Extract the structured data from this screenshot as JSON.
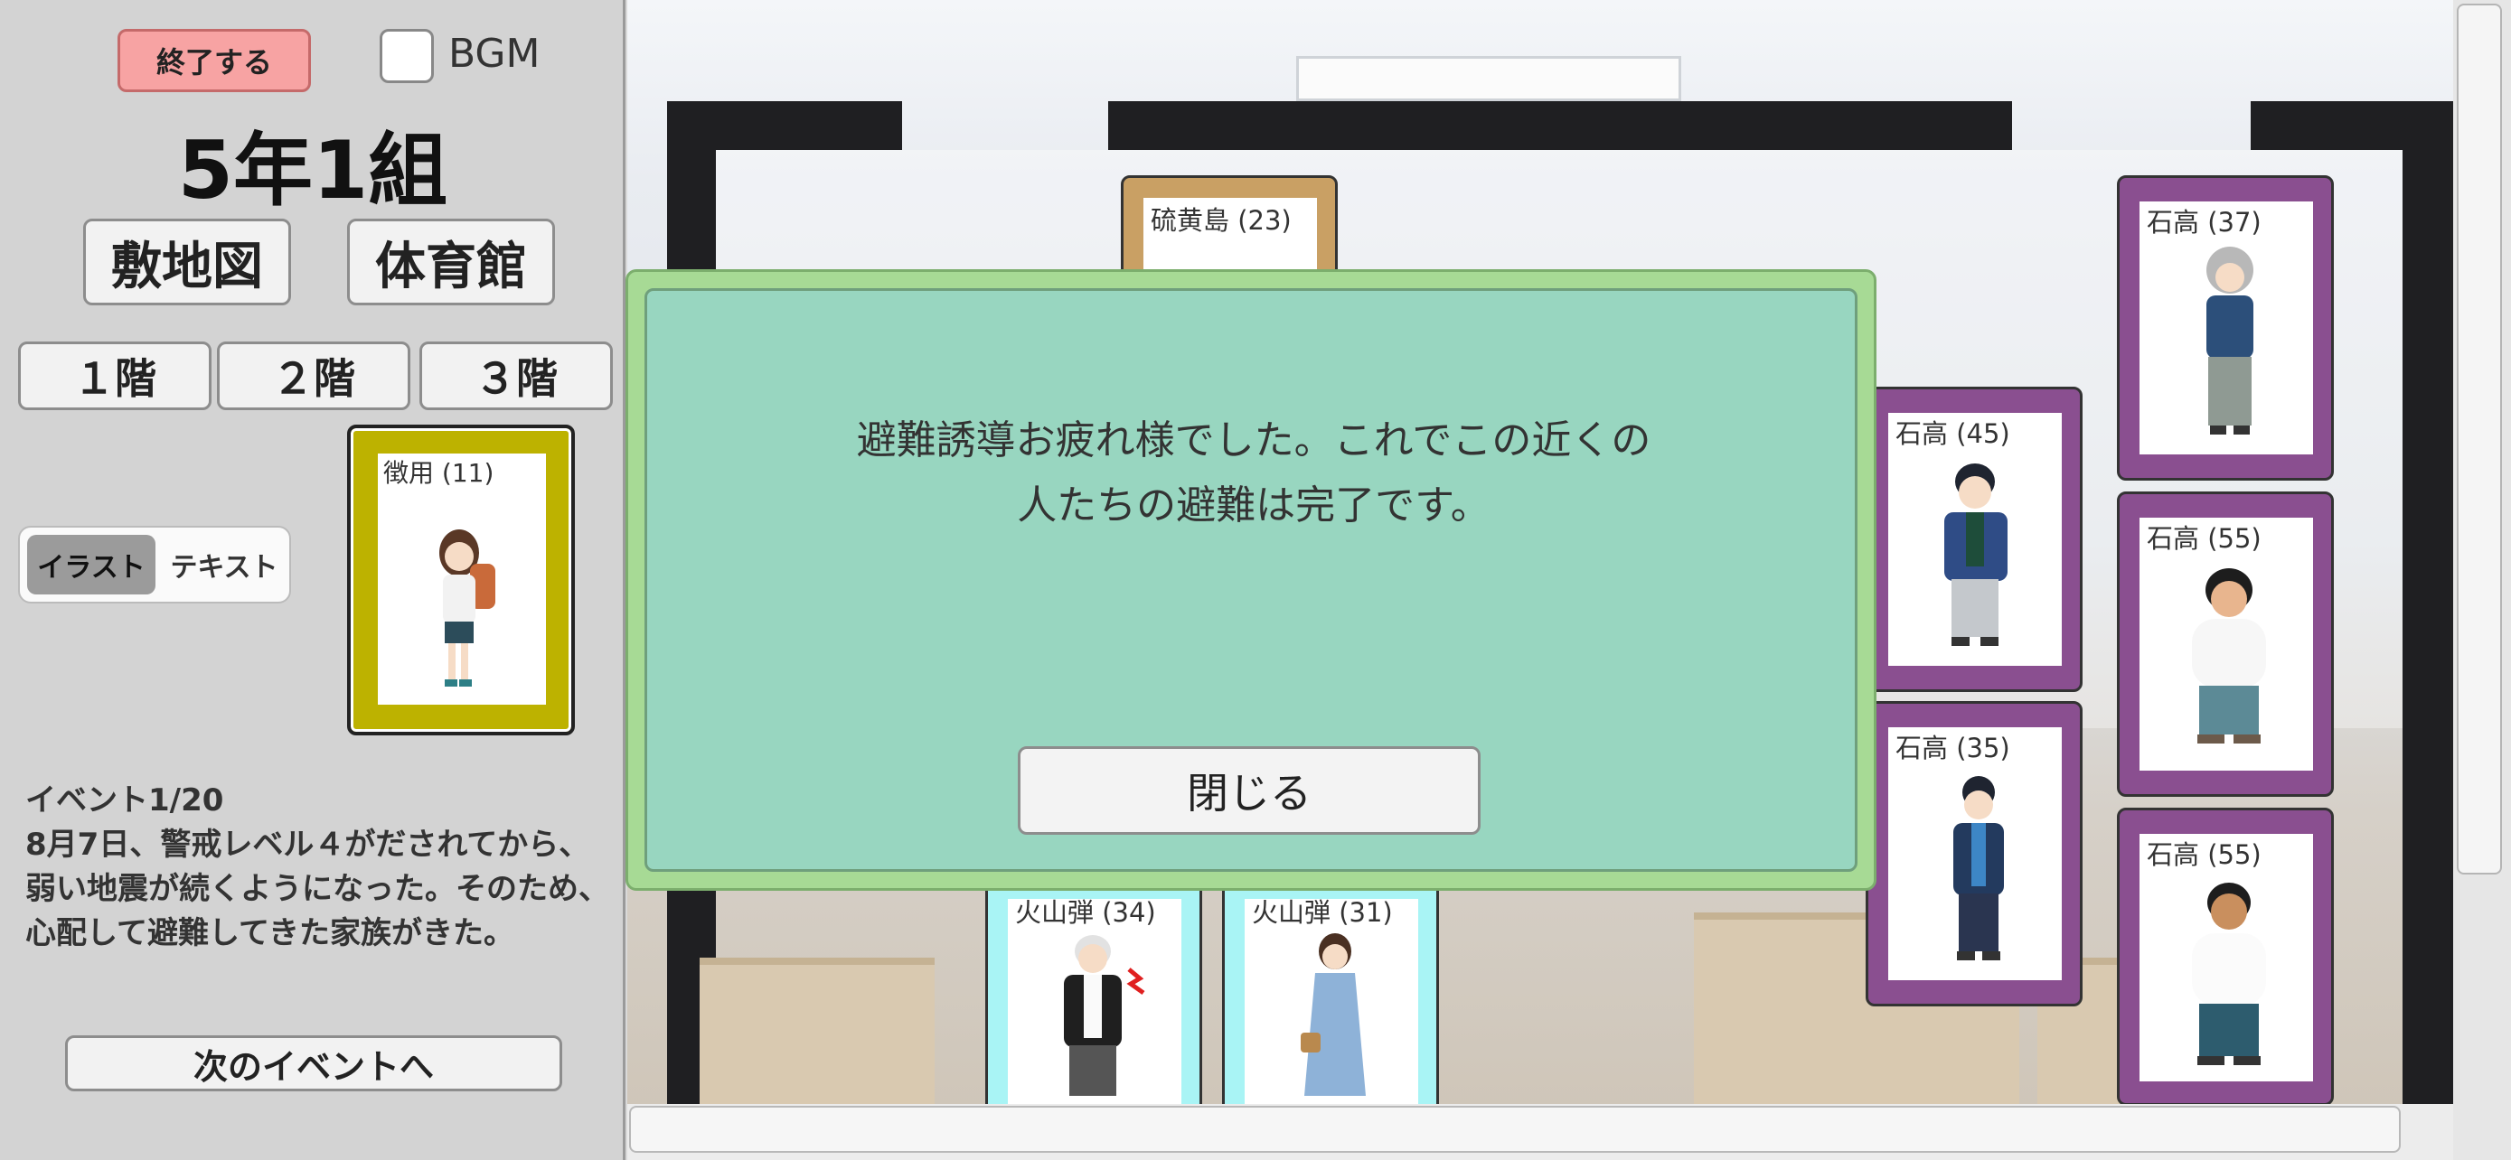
{
  "sidebar": {
    "quit_label": "終了する",
    "bgm_label": "BGM",
    "bgm_checked": false,
    "class_title": "5年1組",
    "map_label": "敷地図",
    "gym_label": "体育館",
    "floors": [
      "１階",
      "２階",
      "３階"
    ],
    "view_toggle": {
      "illust": "イラスト",
      "text": "テキスト",
      "selected": "イラスト"
    },
    "current_card": {
      "name": "徴用 (11)"
    },
    "event": {
      "counter": "イベント1/20",
      "lines": [
        "8月7日、警戒レベル４がだされてから、",
        "弱い地震が続くようになった。そのため、",
        "心配して避難してきた家族がきた。"
      ]
    },
    "next_event_label": "次のイベントへ"
  },
  "cards": [
    {
      "name": "硫黄島 (23)"
    },
    {
      "name": "石高 (37)"
    },
    {
      "name": "石高 (45)"
    },
    {
      "name": "石高 (55)"
    },
    {
      "name": "石高 (35)"
    },
    {
      "name": "石高 (55)"
    },
    {
      "name": "火山弾 (34)"
    },
    {
      "name": "火山弾 (31)"
    }
  ],
  "modal": {
    "message_lines": [
      "避難誘導お疲れ様でした。これでこの近くの",
      "人たちの避難は完了です。"
    ],
    "close_label": "閉じる"
  },
  "colors": {
    "card_purple": "#8a4f90",
    "card_gold": "#c9a064",
    "card_cyan": "#a9f4f5",
    "card_olive": "#bdb200",
    "modal_outer": "#a7da95",
    "modal_inner": "#98d6c0",
    "quit_button": "#f7a3a3"
  }
}
